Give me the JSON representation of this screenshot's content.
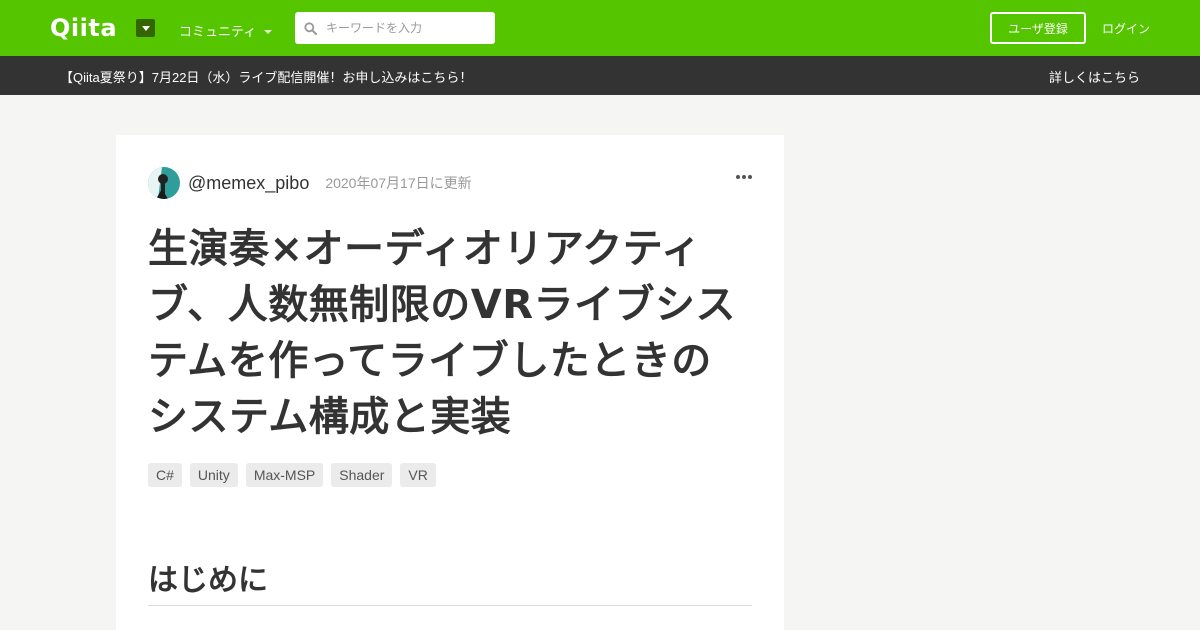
{
  "header": {
    "logo_text": "Qiita",
    "community_label": "コミュニティ",
    "search_placeholder": "キーワードを入力",
    "signup_label": "ユーザ登録",
    "login_label": "ログイン"
  },
  "notice": {
    "text": "【Qiita夏祭り】7月22日（水）ライブ配信開催！お申し込みはこちら！",
    "link_label": "詳しくはこちら"
  },
  "article": {
    "author": "@memex_pibo",
    "updated": "2020年07月17日に更新",
    "title": "生演奏×オーディオリアクティブ、人数無制限のVRライブシステムを作ってライブしたときのシステム構成と実装",
    "tags": [
      "C#",
      "Unity",
      "Max-MSP",
      "Shader",
      "VR"
    ],
    "first_heading": "はじめに"
  },
  "colors": {
    "brand": "#55c500",
    "notice_bg": "#333333"
  }
}
